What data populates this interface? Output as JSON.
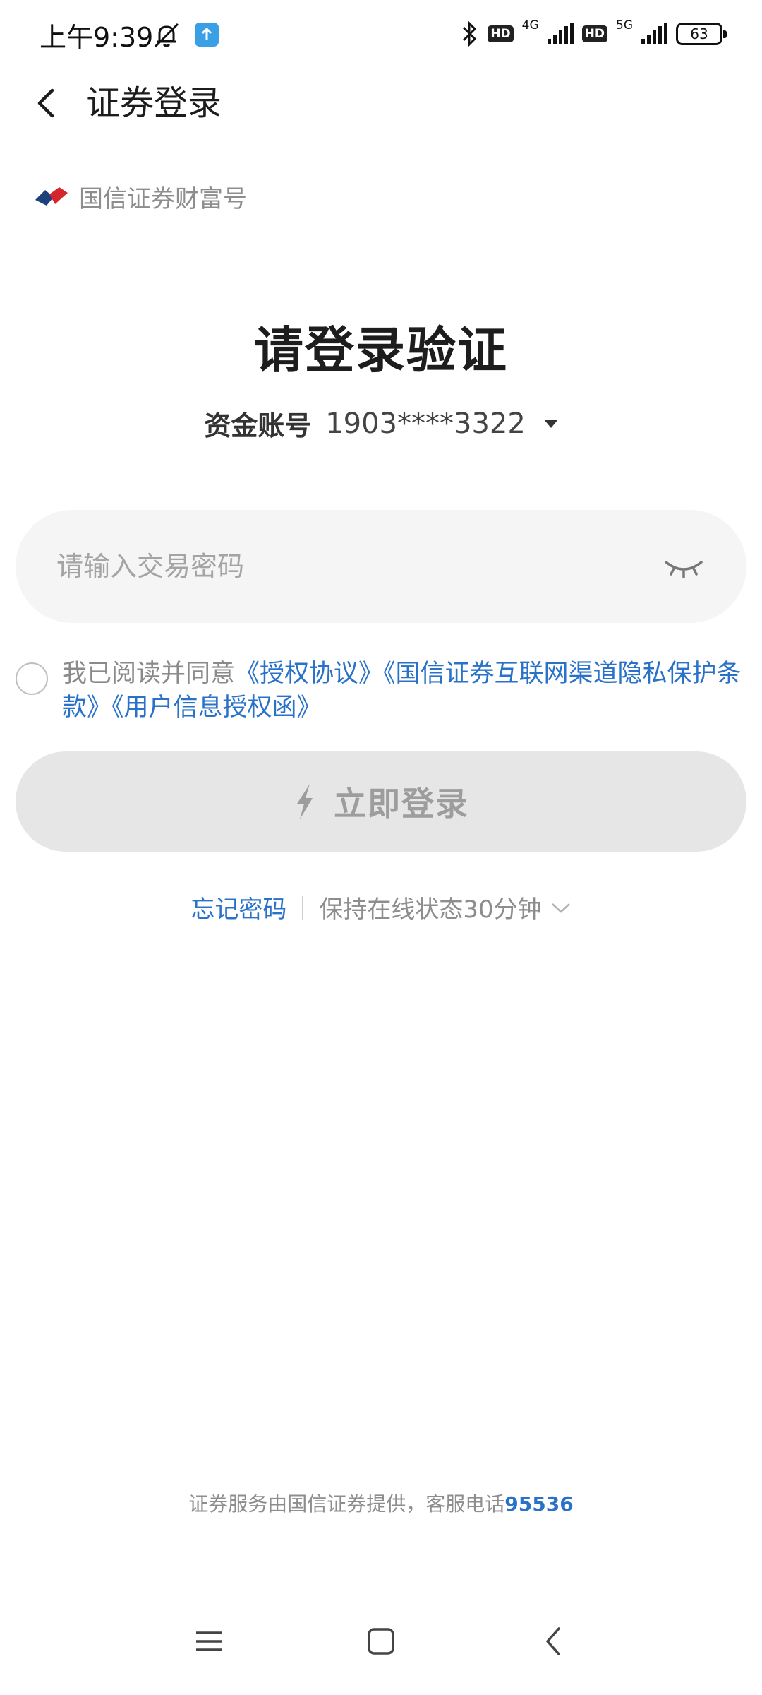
{
  "status_bar": {
    "time": "上午9:39",
    "hd1": "HD",
    "net1": "4G",
    "hd2": "HD",
    "net2": "5G",
    "battery": "63"
  },
  "header": {
    "title": "证券登录",
    "back_icon": "chevron-left-icon"
  },
  "brand": {
    "name": "国信证券财富号"
  },
  "main": {
    "title": "请登录验证",
    "account_label": "资金账号",
    "account_value": "1903****3322",
    "password_placeholder": "请输入交易密码",
    "agreement_prefix": "我已阅读并同意",
    "agreement_links": [
      "《授权协议》",
      "《国信证券互联网渠道隐私保护条款》",
      "《用户信息授权函》"
    ],
    "login_label": "立即登录",
    "forgot_label": "忘记密码",
    "keep_online_label": "保持在线状态30分钟"
  },
  "footer": {
    "text": "证券服务由国信证券提供，客服电话",
    "phone": "95536"
  },
  "colors": {
    "link": "#2a72c8",
    "login_bg": "#e6e6e6",
    "input_bg": "#f5f5f5"
  }
}
